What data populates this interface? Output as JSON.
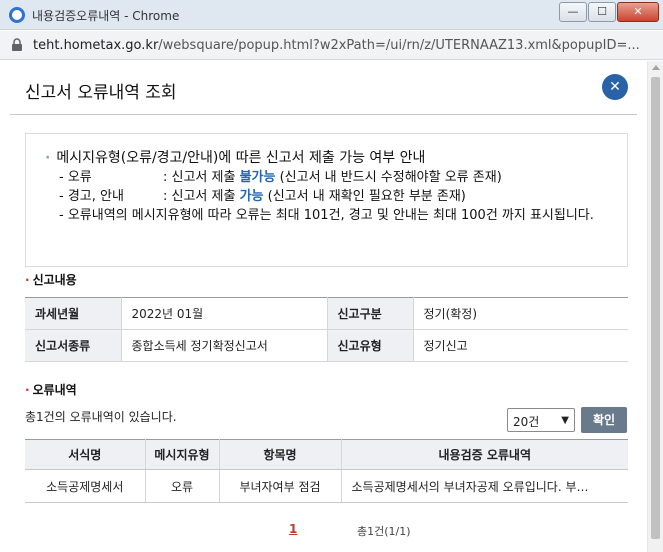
{
  "window": {
    "title": "내용검증오류내역 - Chrome",
    "url_host": "teht.hometax.go.kr",
    "url_path": "/websquare/popup.html?w2xPath=/ui/rn/z/UTERNAAZ13.xml&popupID=..."
  },
  "popup": {
    "title": "신고서 오류내역 조회",
    "close_glyph": "✕"
  },
  "notice": {
    "heading": "메시지유형(오류/경고/안내)에 따른 신고서 제출 가능 여부 안내",
    "error_key": "- 오류",
    "error_pre": ": 신고서 제출 ",
    "error_blue": "불가능",
    "error_post": " (신고서 내 반드시 수정해야할 오류 존재)",
    "warn_key": "- 경고, 안내",
    "warn_pre": ": 신고서 제출 ",
    "warn_blue": "가능",
    "warn_post": " (신고서 내 재확인 필요한 부분 존재)",
    "limit_text": "- 오류내역의 메시지유형에 따라 오류는 최대 101건, 경고 및 안내는 최대 100건 까지 표시됩니다."
  },
  "report_info": {
    "section_title": "신고내용",
    "tax_year_label": "과세년월",
    "tax_year_value": "2022년 01월",
    "report_type_label": "신고구분",
    "report_type_value": "정기(확정)",
    "form_type_label": "신고서종류",
    "form_type_value": "종합소득세 정기확정신고서",
    "filing_type_label": "신고유형",
    "filing_type_value": "정기신고"
  },
  "error_list": {
    "section_title": "오류내역",
    "count_text": "총1건의 오류내역이 있습니다.",
    "page_size": "20건",
    "confirm_label": "확인",
    "headers": [
      "서식명",
      "메시지유형",
      "항목명",
      "내용검증 오류내역"
    ],
    "rows": [
      [
        "소득공제명세서",
        "오류",
        "부녀자여부 점검",
        "소득공제명세서의 부녀자공제 오류입니다. 부…"
      ]
    ]
  },
  "pager": {
    "current_page": "1",
    "total": "총1건(1/1)"
  },
  "window_buttons": {
    "minimize": "—",
    "maximize": "☐",
    "close": "✕"
  },
  "colors": {
    "accent": "#2a62a8",
    "highlight": "#2365b8",
    "page_link": "#c43a2a"
  }
}
